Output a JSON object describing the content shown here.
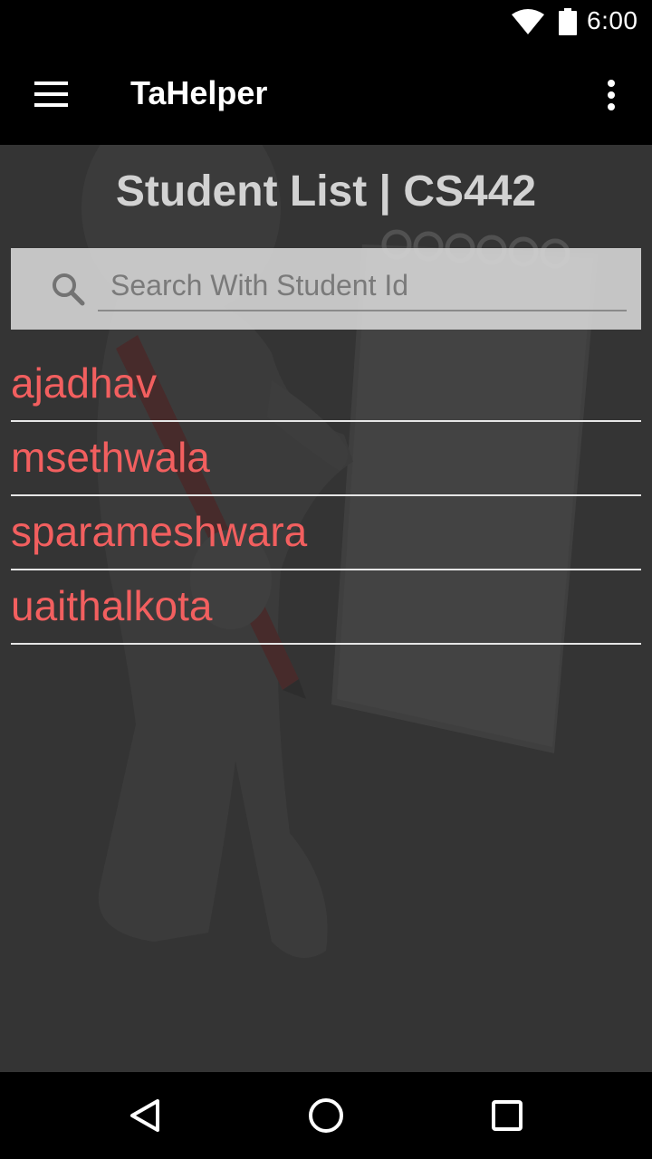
{
  "status_bar": {
    "time": "6:00",
    "icons": [
      "wifi-icon",
      "battery-icon"
    ]
  },
  "app_bar": {
    "title": "TaHelper",
    "menu_icon": "hamburger-menu-icon",
    "overflow_icon": "more-vert-icon"
  },
  "main": {
    "page_title": "Student List | CS442",
    "search": {
      "placeholder": "Search With Student Id",
      "value": "",
      "icon": "search-icon"
    },
    "students": [
      {
        "id": "ajadhav"
      },
      {
        "id": "msethwala"
      },
      {
        "id": "sparameshwara"
      },
      {
        "id": "uaithalkota"
      }
    ]
  },
  "nav_bar": {
    "icons": [
      "back-icon",
      "home-icon",
      "recents-icon"
    ]
  },
  "colors": {
    "background": "#343434",
    "bars": "#000000",
    "title_text": "#d2d2d2",
    "student_text": "#f25f5f",
    "divider": "#e6e6e6",
    "search_bg": "#dadada"
  }
}
